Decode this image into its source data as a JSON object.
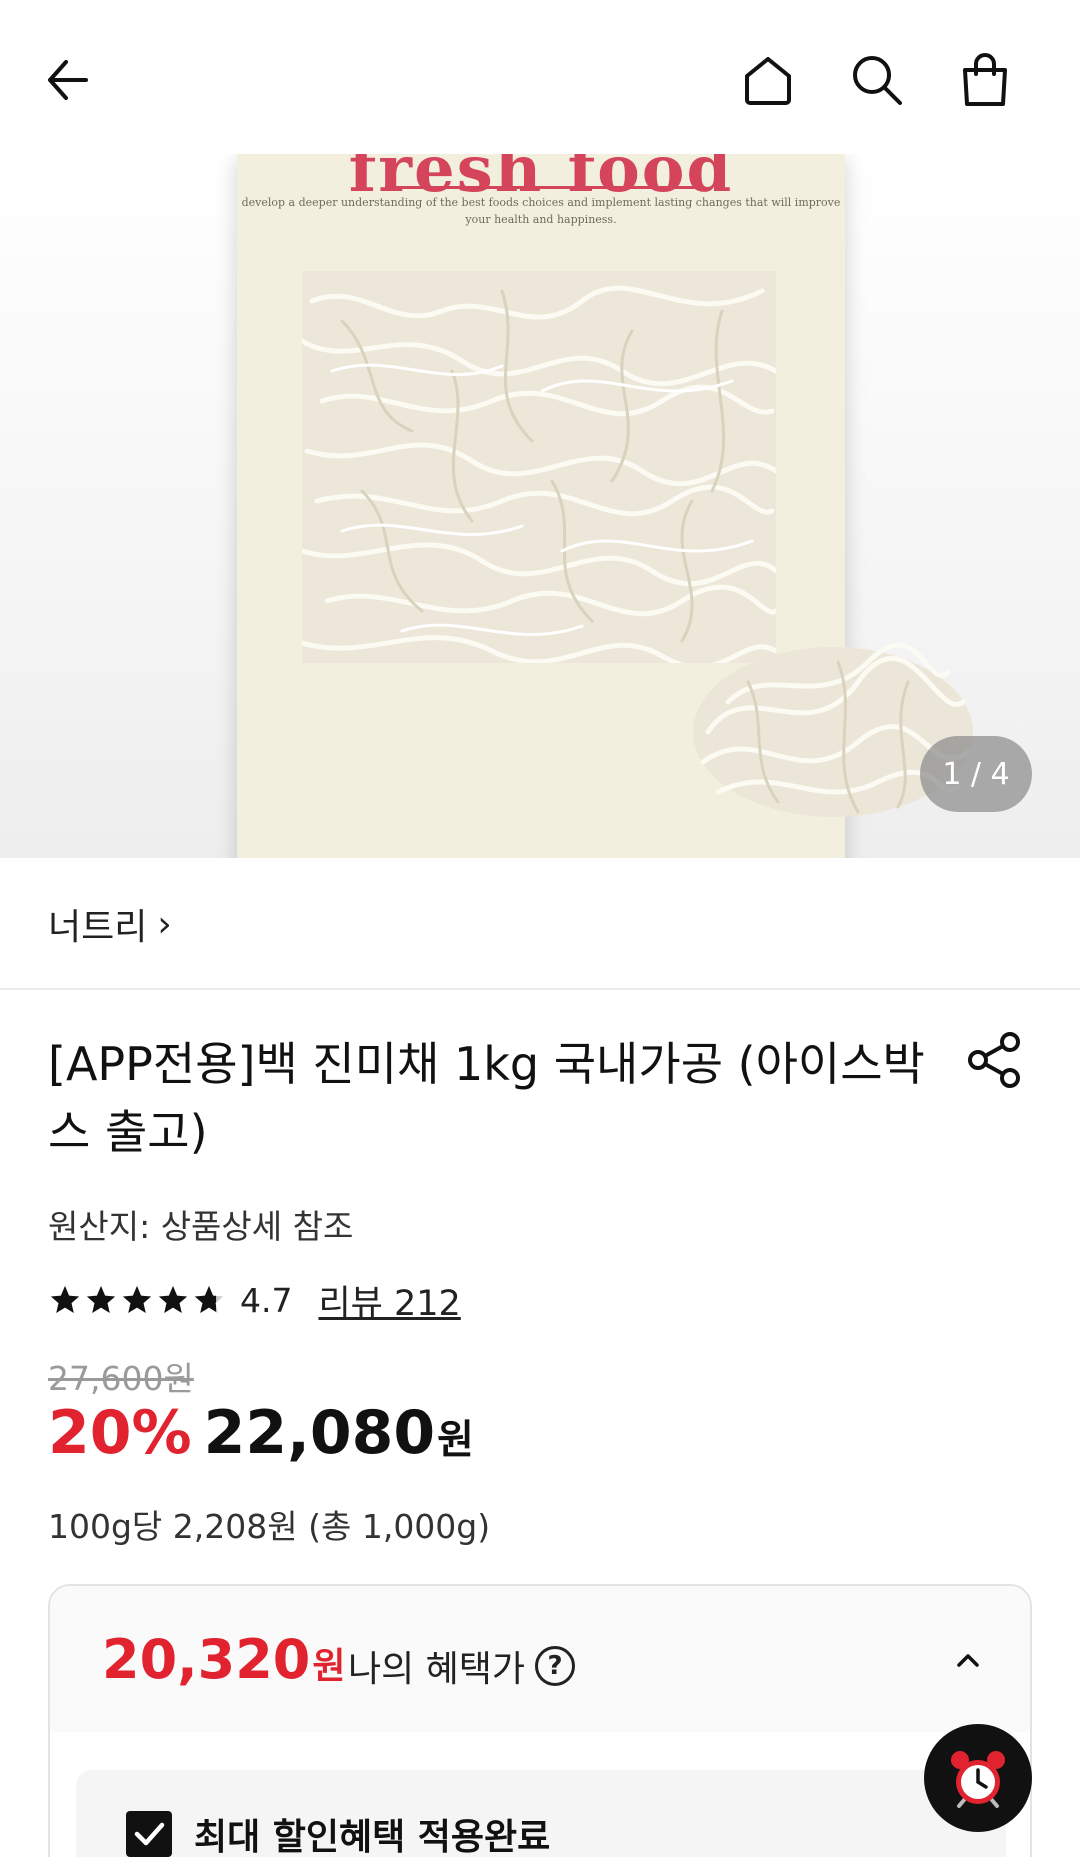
{
  "nav": {
    "icons": [
      "back-arrow-icon",
      "home-icon",
      "search-icon",
      "shopping-bag-icon"
    ]
  },
  "hero": {
    "brand_text": "fresh food",
    "tagline": "develop a deeper understanding of the best foods choices and implement lasting changes that will improve your health and happiness.",
    "image_counter": "1 / 4"
  },
  "seller": {
    "name": "너트리",
    "chevron": "›"
  },
  "product": {
    "title": "[APP전용]백 진미채 1kg 국내가공 (아이스박스 출고)",
    "origin": "원산지: 상품상세 참조",
    "rating_value": "4.7",
    "stars": 4.7,
    "reviews_label": "리뷰 212",
    "original_price": "27,600원",
    "discount": "20%",
    "price": "22,080",
    "currency": "원",
    "unit_price": "100g당 2,208원 (총 1,000g)"
  },
  "benefit": {
    "price": "20,320",
    "currency": "원",
    "label": "나의 혜택가",
    "help": "?",
    "applied_label": "최대 할인혜택 적용완료"
  },
  "colors": {
    "accent": "#e0232e",
    "brand": "#d4445a",
    "text": "#111111"
  }
}
